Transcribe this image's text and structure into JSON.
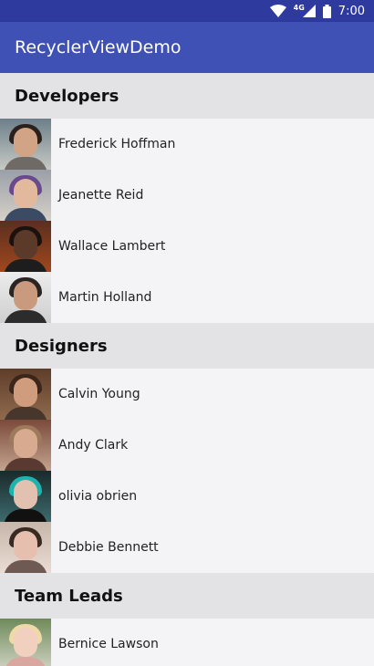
{
  "status_bar": {
    "time": "7:00",
    "network": "4G"
  },
  "app_bar": {
    "title": "RecyclerViewDemo"
  },
  "sections": [
    {
      "title": "Developers",
      "people": [
        {
          "name": "Frederick Hoffman"
        },
        {
          "name": "Jeanette Reid"
        },
        {
          "name": "Wallace Lambert"
        },
        {
          "name": "Martin Holland"
        }
      ]
    },
    {
      "title": "Designers",
      "people": [
        {
          "name": "Calvin Young"
        },
        {
          "name": "Andy Clark"
        },
        {
          "name": "olivia obrien"
        },
        {
          "name": "Debbie Bennett"
        }
      ]
    },
    {
      "title": "Team Leads",
      "people": [
        {
          "name": "Bernice Lawson"
        }
      ]
    }
  ],
  "colors": {
    "status_bar": "#2e3a9e",
    "app_bar": "#3f51b5",
    "section_header": "#e3e3e5",
    "row_bg": "#f4f4f6"
  }
}
